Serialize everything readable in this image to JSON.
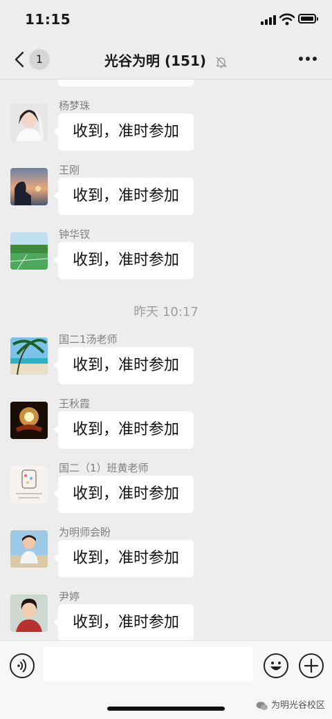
{
  "status_bar": {
    "time": "11:15"
  },
  "header": {
    "back_badge": "1",
    "title": "光谷为明 (151)"
  },
  "messages": [
    {
      "sender": "杨梦珠",
      "text": "收到，准时参加",
      "avatar": "photo-woman-bride"
    },
    {
      "sender": "王刚",
      "text": "收到，准时参加",
      "avatar": "photo-sunset-silhouette"
    },
    {
      "sender": "钟华钗",
      "text": "收到，准时参加",
      "avatar": "photo-sports-field"
    },
    {
      "sender": "国二1汤老师",
      "text": "收到，准时参加",
      "avatar": "photo-beach-palm"
    },
    {
      "sender": "王秋霞",
      "text": "收到，准时参加",
      "avatar": "photo-glowing-book"
    },
    {
      "sender": "国二（1）班黄老师",
      "text": "收到，准时参加",
      "avatar": "illustration-jar-quote"
    },
    {
      "sender": "为明师会盼",
      "text": "收到，准时参加",
      "avatar": "photo-girl-smiling"
    },
    {
      "sender": "尹婷",
      "text": "收到，准时参加",
      "avatar": "photo-woman-portrait"
    }
  ],
  "timestamp": "昨天 10:17",
  "input_bar": {
    "placeholder": ""
  },
  "watermark": "为明光谷校区",
  "icons": {
    "back": "chevron-left-icon",
    "mute": "bell-off-icon",
    "more": "more-dots-icon",
    "voice": "voice-icon",
    "emoji": "emoji-icon",
    "plus": "plus-icon"
  }
}
